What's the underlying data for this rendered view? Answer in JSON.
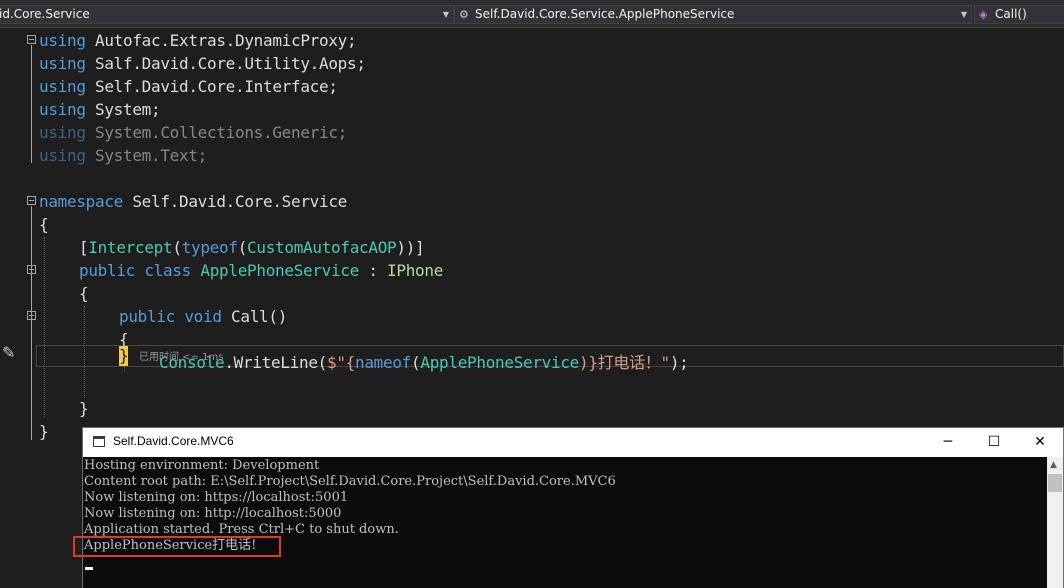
{
  "navbar": {
    "project": "id.Core.Service",
    "type": "Self.David.Core.Service.ApplePhoneService",
    "member": "Call()"
  },
  "code": {
    "using": "using",
    "ns1": "Autofac.Extras.DynamicProxy;",
    "ns2": "Salf.David.Core.Utility.Aops;",
    "ns3": "Self.David.Core.Interface;",
    "ns4": "System;",
    "ns5": "System.Collections.Generic;",
    "ns6": "System.Text;",
    "namespace_kw": "namespace",
    "namespace_name": "Self.David.Core.Service",
    "open_brace": "{",
    "close_brace": "}",
    "attr_open": "[",
    "attr_name": "Intercept",
    "attr_paren_open": "(",
    "typeof_kw": "typeof",
    "aop_type": "CustomAutofacAOP",
    "attr_close": "))]",
    "public_kw": "public",
    "class_kw": "class",
    "class_name": "ApplePhoneService",
    "colon": " : ",
    "interface_name": "IPhone",
    "void_kw": "void",
    "method_name": "Call()",
    "console_type": "Console",
    "writeline": ".WriteLine(",
    "str_start": "$\"{",
    "nameof_kw": "nameof",
    "paren_open": "(",
    "class_ref": "ApplePhoneService",
    "str_end": ")}打电话！\"",
    "stmt_end": ");",
    "perf_tip": "已用时间 <= 1ms"
  },
  "console": {
    "title": "Self.David.Core.MVC6",
    "minimize": "─",
    "maximize": "☐",
    "close": "✕",
    "lines": [
      "Hosting environment: Development",
      "Content root path: E:\\Self.Project\\Self.David.Core.Project\\Self.David.Core.MVC6",
      "Now listening on: https://localhost:5001",
      "Now listening on: http://localhost:5000",
      "Application started. Press Ctrl+C to shut down.",
      "ApplePhoneService打电话!"
    ]
  },
  "colors": {
    "keyword": "#569cd6",
    "type": "#4ec9b0",
    "string": "#d69d85",
    "highlight_box": "#e0382f"
  }
}
